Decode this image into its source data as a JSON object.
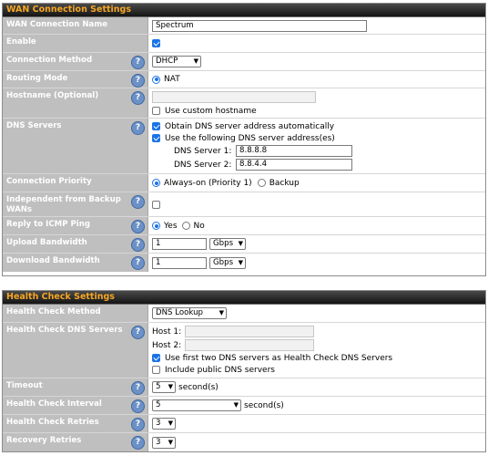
{
  "wan": {
    "header": "WAN Connection Settings",
    "connection_name": {
      "label": "WAN Connection Name",
      "value": "Spectrum"
    },
    "enable": {
      "label": "Enable"
    },
    "connection_method": {
      "label": "Connection Method",
      "value": "DHCP"
    },
    "routing_mode": {
      "label": "Routing Mode",
      "option": "NAT"
    },
    "hostname": {
      "label": "Hostname (Optional)",
      "value": "",
      "checkbox_label": "Use custom hostname"
    },
    "dns": {
      "label": "DNS Servers",
      "auto_label": "Obtain DNS server address automatically",
      "manual_label": "Use the following DNS server address(es)",
      "server1_label": "DNS Server 1:",
      "server1_value": "8.8.8.8",
      "server2_label": "DNS Server 2:",
      "server2_value": "8.8.4.4"
    },
    "priority": {
      "label": "Connection Priority",
      "option1": "Always-on (Priority 1)",
      "option2": "Backup"
    },
    "independent": {
      "label": "Independent from Backup WANs"
    },
    "icmp": {
      "label": "Reply to ICMP Ping",
      "yes": "Yes",
      "no": "No"
    },
    "upload": {
      "label": "Upload Bandwidth",
      "value": "1",
      "unit": "Gbps"
    },
    "download": {
      "label": "Download Bandwidth",
      "value": "1",
      "unit": "Gbps"
    }
  },
  "health": {
    "header": "Health Check Settings",
    "method": {
      "label": "Health Check Method",
      "value": "DNS Lookup"
    },
    "dns_servers": {
      "label": "Health Check DNS Servers",
      "host1_label": "Host 1:",
      "host1_value": "",
      "host2_label": "Host 2:",
      "host2_value": "",
      "first_two_label": "Use first two DNS servers as Health Check DNS Servers",
      "public_label": "Include public DNS servers"
    },
    "timeout": {
      "label": "Timeout",
      "value": "5",
      "unit": "second(s)"
    },
    "interval": {
      "label": "Health Check Interval",
      "value": "5",
      "unit": "second(s)"
    },
    "retries": {
      "label": "Health Check Retries",
      "value": "3"
    },
    "recovery": {
      "label": "Recovery Retries",
      "value": "3"
    }
  }
}
